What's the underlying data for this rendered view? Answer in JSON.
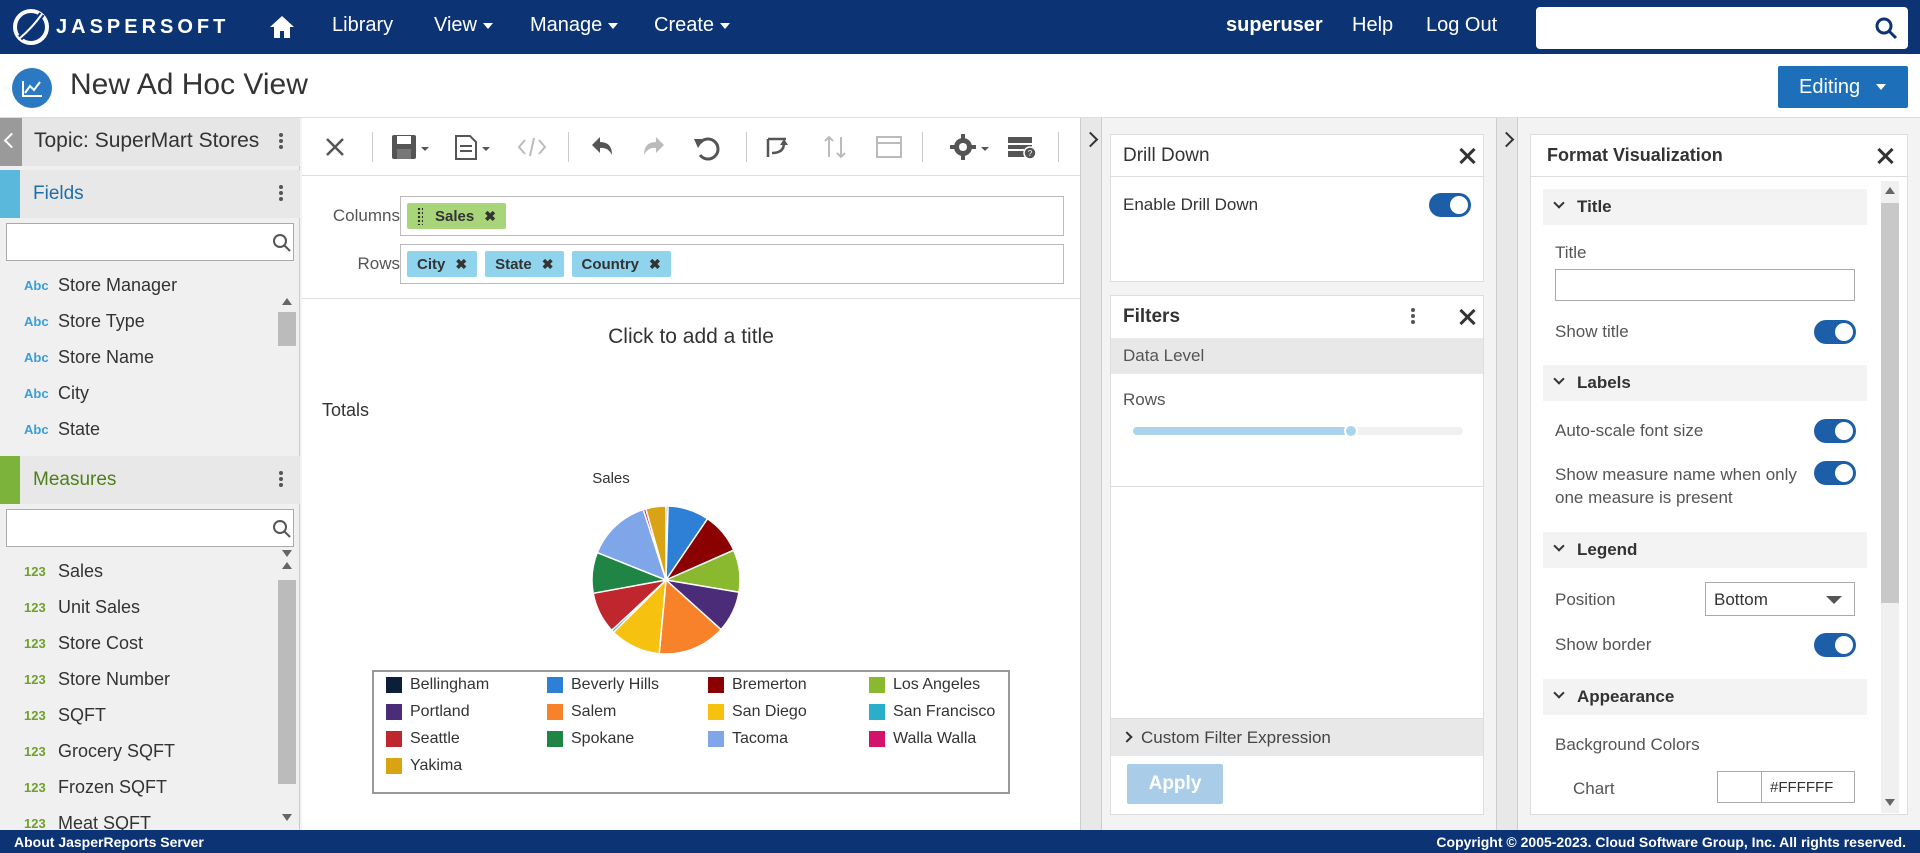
{
  "brand": {
    "name": "JASPERSOFT"
  },
  "nav": {
    "library": "Library",
    "view": "View",
    "manage": "Manage",
    "create": "Create",
    "user": "superuser",
    "help": "Help",
    "logout": "Log Out",
    "search_placeholder": ""
  },
  "page": {
    "title": "New Ad Hoc View",
    "mode": "Editing"
  },
  "left_panel": {
    "topic": "Topic: SuperMart Stores",
    "fields_header": "Fields",
    "fields": [
      {
        "type": "Abc",
        "label": "Store Manager"
      },
      {
        "type": "Abc",
        "label": "Store Type"
      },
      {
        "type": "Abc",
        "label": "Store Name"
      },
      {
        "type": "Abc",
        "label": "City"
      },
      {
        "type": "Abc",
        "label": "State"
      }
    ],
    "measures_header": "Measures",
    "measures": [
      {
        "type": "123",
        "label": "Sales"
      },
      {
        "type": "123",
        "label": "Unit Sales"
      },
      {
        "type": "123",
        "label": "Store Cost"
      },
      {
        "type": "123",
        "label": "Store Number"
      },
      {
        "type": "123",
        "label": "SQFT"
      },
      {
        "type": "123",
        "label": "Grocery SQFT"
      },
      {
        "type": "123",
        "label": "Frozen SQFT"
      },
      {
        "type": "123",
        "label": "Meat SQFT"
      }
    ]
  },
  "center": {
    "columns_label": "Columns",
    "rows_label": "Rows",
    "column_pills": [
      "Sales"
    ],
    "row_pills": [
      "City",
      "State",
      "Country"
    ],
    "chart_title_placeholder": "Click to add a title",
    "totals_label": "Totals"
  },
  "chart_data": {
    "type": "pie",
    "title": "Sales",
    "categories": [
      "Bellingham",
      "Beverly Hills",
      "Bremerton",
      "Los Angeles",
      "Portland",
      "Salem",
      "San Diego",
      "San Francisco",
      "Seattle",
      "Spokane",
      "Tacoma",
      "Walla Walla",
      "Yakima"
    ],
    "values": [
      0.4,
      8.0,
      7.9,
      8.2,
      8.0,
      13.1,
      9.8,
      0.5,
      8.0,
      7.9,
      12.4,
      0.5,
      3.9
    ],
    "colors": [
      "#0b1f3b",
      "#2e7fd6",
      "#8b0000",
      "#8ab82e",
      "#4b2c78",
      "#f7822a",
      "#f6c20f",
      "#29afc9",
      "#c0262d",
      "#1f8444",
      "#7ea6e8",
      "#d4126b",
      "#d8a413"
    ],
    "legend_position": "bottom"
  },
  "drill_down": {
    "title": "Drill Down",
    "enable_label": "Enable Drill Down"
  },
  "filters": {
    "title": "Filters",
    "data_level": "Data Level",
    "rows_label": "Rows",
    "slider_level": 0.66,
    "custom_expression": "Custom Filter Expression",
    "apply": "Apply"
  },
  "format": {
    "title": "Format Visualization",
    "sections": {
      "title": "Title",
      "labels": "Labels",
      "legend": "Legend",
      "appearance": "Appearance"
    },
    "title_field_label": "Title",
    "title_value": "",
    "show_title": "Show title",
    "auto_scale": "Auto-scale font size",
    "show_measure_name": "Show measure name when only one measure is present",
    "position_label": "Position",
    "position_value": "Bottom",
    "show_border": "Show border",
    "background_colors": "Background Colors",
    "chart_label": "Chart",
    "chart_color": "#FFFFFF"
  },
  "footer": {
    "left": "About JasperReports Server",
    "right": "Copyright © 2005-2023. Cloud Software Group, Inc. All rights reserved."
  }
}
